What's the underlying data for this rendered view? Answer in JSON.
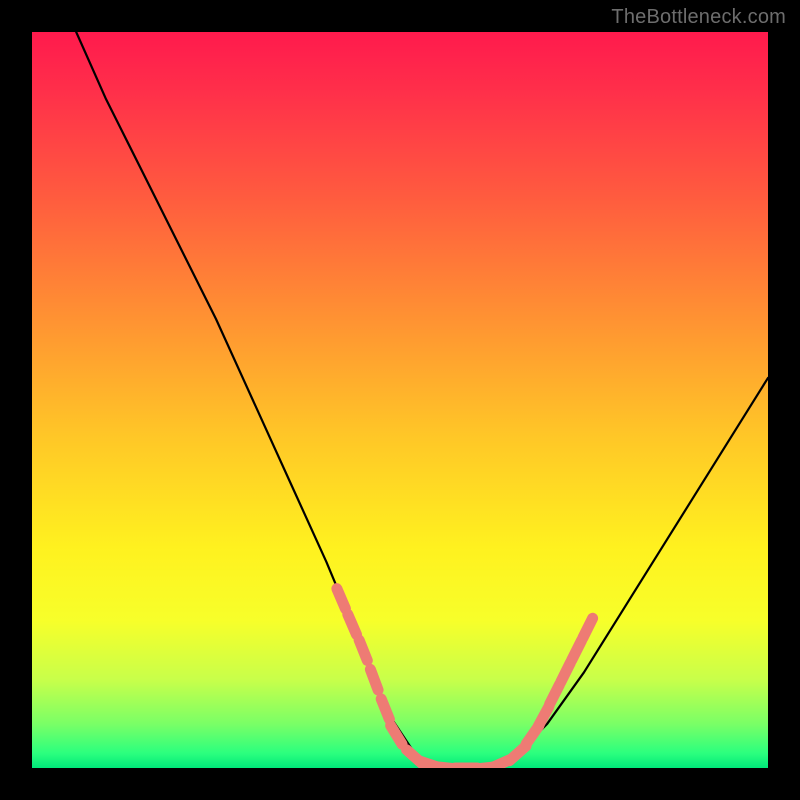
{
  "watermark": "TheBottleneck.com",
  "chart_data": {
    "type": "line",
    "title": "",
    "xlabel": "",
    "ylabel": "",
    "xlim": [
      0,
      100
    ],
    "ylim": [
      0,
      100
    ],
    "series": [
      {
        "name": "bottleneck-curve",
        "x": [
          6,
          10,
          15,
          20,
          25,
          30,
          35,
          40,
          45,
          48,
          52,
          55,
          58,
          62,
          66,
          70,
          75,
          80,
          85,
          90,
          95,
          100
        ],
        "y": [
          100,
          91,
          81,
          71,
          61,
          50,
          39,
          28,
          16,
          8,
          2,
          0,
          0,
          0,
          2,
          6,
          13,
          21,
          29,
          37,
          45,
          53
        ]
      }
    ],
    "markers": {
      "name": "highlighted-points",
      "color": "#ee7b74",
      "points": [
        {
          "x": 42,
          "y": 23
        },
        {
          "x": 43.5,
          "y": 19.5
        },
        {
          "x": 45,
          "y": 16
        },
        {
          "x": 46.5,
          "y": 12
        },
        {
          "x": 48,
          "y": 8
        },
        {
          "x": 49.5,
          "y": 4.5
        },
        {
          "x": 52,
          "y": 1.5
        },
        {
          "x": 54,
          "y": 0.5
        },
        {
          "x": 56.5,
          "y": 0
        },
        {
          "x": 59,
          "y": 0
        },
        {
          "x": 61.5,
          "y": 0
        },
        {
          "x": 63.5,
          "y": 0.5
        },
        {
          "x": 66,
          "y": 2
        },
        {
          "x": 68,
          "y": 4.5
        },
        {
          "x": 69.5,
          "y": 7
        },
        {
          "x": 71,
          "y": 10
        },
        {
          "x": 72.5,
          "y": 13
        },
        {
          "x": 74,
          "y": 16
        },
        {
          "x": 75.5,
          "y": 19
        }
      ]
    },
    "gradient_stops": [
      {
        "pct": 0,
        "color": "#ff1a4d"
      },
      {
        "pct": 22,
        "color": "#ff5a3f"
      },
      {
        "pct": 55,
        "color": "#ffc727"
      },
      {
        "pct": 80,
        "color": "#f7ff2a"
      },
      {
        "pct": 94,
        "color": "#7aff66"
      },
      {
        "pct": 100,
        "color": "#00e87a"
      }
    ]
  }
}
